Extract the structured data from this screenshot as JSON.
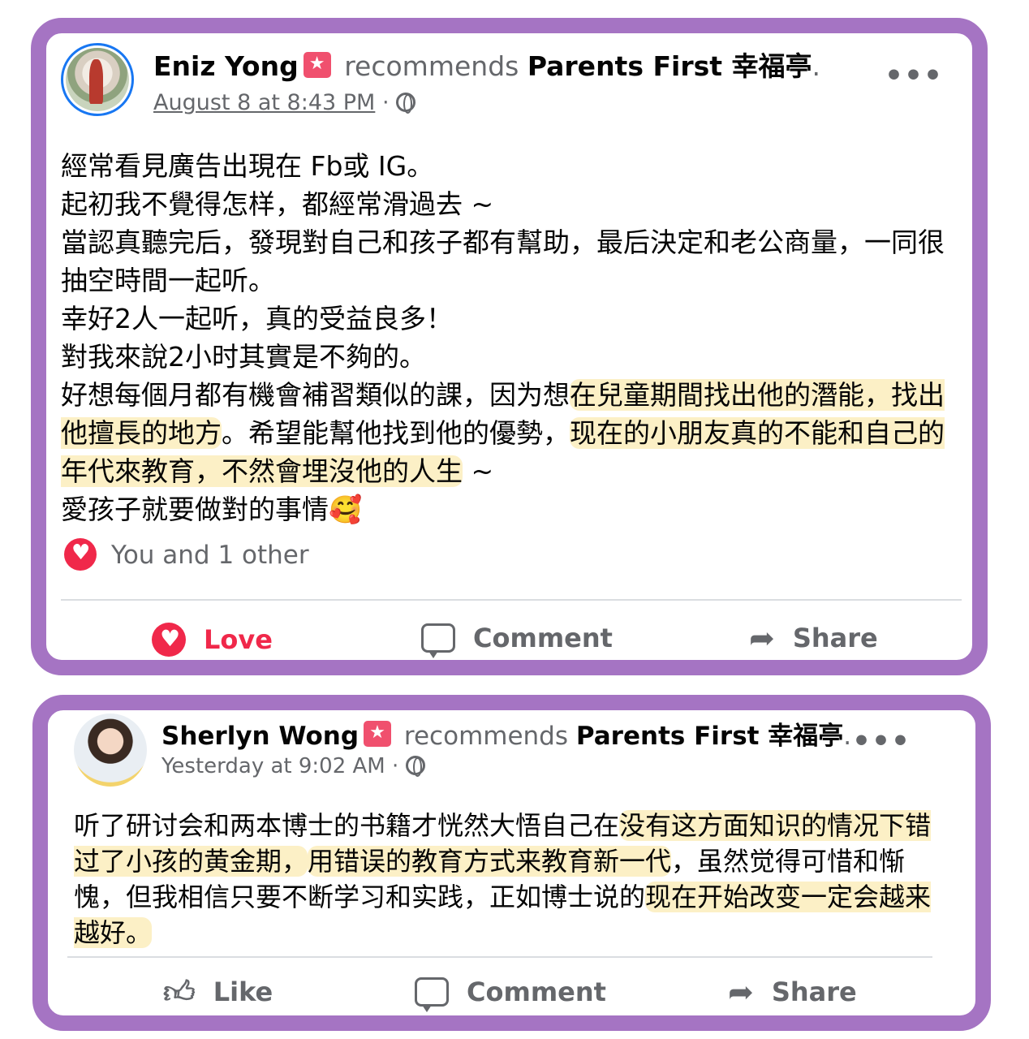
{
  "posts": [
    {
      "author": "Eniz Yong",
      "recommends_text": "recommends",
      "page_name": "Parents First 幸福亭",
      "page_suffix": ".",
      "timestamp": "August 8 at 8:43 PM",
      "separator": "·",
      "more_label": "•••",
      "body": {
        "l1": "經常看見廣告出現在 Fb或 IG。",
        "l2": "起初我不覺得怎样，都經常滑過去 ~",
        "l3": "當認真聽完后，發現對自己和孩子都有幫助，最后決定和老公商量，一同很抽空時間一起听。",
        "l4": "幸好2人一起听，真的受益良多！",
        "l5": "對我來說2小时其實是不夠的。",
        "l6a": "好想每個月都有機會補習類似的課，因为想",
        "l6b": "在兒童期間找出他的潛能，找出他擅長的地方",
        "l6c": "。希望能幫他找到他的優勢，",
        "l6d": "现在的小朋友真的不能和自己的年代來教育，不然會埋沒他的人生",
        "l6e": " ~",
        "l7": "愛孩子就要做對的事情🥰"
      },
      "reactions_text": "You and 1 other",
      "actions": {
        "love": "Love",
        "comment": "Comment",
        "share": "Share"
      }
    },
    {
      "author": "Sherlyn Wong",
      "recommends_text": "recommends",
      "page_name": "Parents First 幸福亭",
      "page_suffix": ".",
      "timestamp": "Yesterday at 9:02 AM",
      "separator": "·",
      "more_label": "•••",
      "body": {
        "s1": "听了研讨会和两本博士的书籍才恍然大悟自己在",
        "s2": "没有这方面知识的情况下错过了小孩的黄金期，",
        "s3": "用错误的教育方式来教育新一代",
        "s4": "，虽然觉得可惜和惭愧，但我相信只要不断学习和实践，正如博士说的",
        "s5": "现在开始改变一定会越来越好。"
      },
      "actions": {
        "like": "Like",
        "comment": "Comment",
        "share": "Share"
      }
    }
  ],
  "colors": {
    "frame": "#a574c3",
    "highlight": "#fcf0c6",
    "love": "#f0284a",
    "muted": "#65676b"
  },
  "icons": [
    "recommend-badge-icon",
    "globe-icon",
    "more-icon",
    "heart-icon",
    "comment-icon",
    "share-icon",
    "like-icon"
  ]
}
